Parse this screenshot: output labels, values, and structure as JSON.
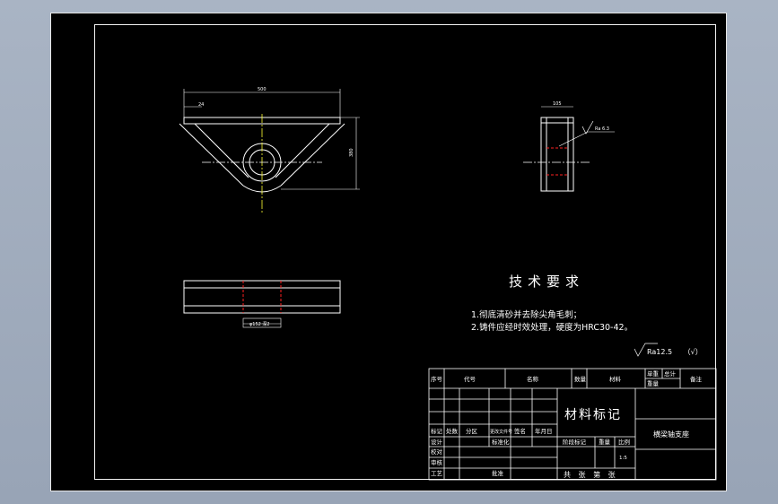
{
  "drawing": {
    "front_view": {
      "dim_width": "500",
      "dim_small": "24",
      "dim_height": "380"
    },
    "side_view": {
      "dim_width": "105",
      "roughness": "Ra 6.3"
    },
    "bottom_view": {
      "dim_label": "φ152 深2"
    }
  },
  "tech_requirements": {
    "title": "技术要求",
    "items": [
      "1.彻底清砂并去除尖角毛刺；",
      "2.铸件应经时效处理，硬度为HRC30-42。"
    ]
  },
  "roughness_note": {
    "value": "Ra12.5",
    "mark": "（√）"
  },
  "title_block": {
    "parts_header": {
      "seq": "序号",
      "code": "代号",
      "name": "名称",
      "qty": "数量",
      "material": "材料",
      "unit_weight": "单重",
      "total_weight": "总计",
      "weight_label": "重量",
      "remark": "备注"
    },
    "revision_labels": {
      "mark": "标记",
      "count": "处数",
      "zone": "分区",
      "doc": "更改文件号",
      "sign": "签名",
      "date": "年月日"
    },
    "approval_labels": {
      "design": "设计",
      "standard": "标准化",
      "check": "审核",
      "process": "工艺",
      "approve": "批准",
      "proofread": "校对"
    },
    "material_mark": "材料标记",
    "stage_labels": {
      "stage": "阶段标记",
      "weight": "重量",
      "scale": "比例"
    },
    "scale_value": "1:5",
    "sheet_label": "共 张 第 张",
    "part_name": "横梁轴支座"
  },
  "colors": {
    "line": "#ffffff",
    "centerline": "#ffff33",
    "hidden": "#ff2020",
    "background": "#000000"
  }
}
